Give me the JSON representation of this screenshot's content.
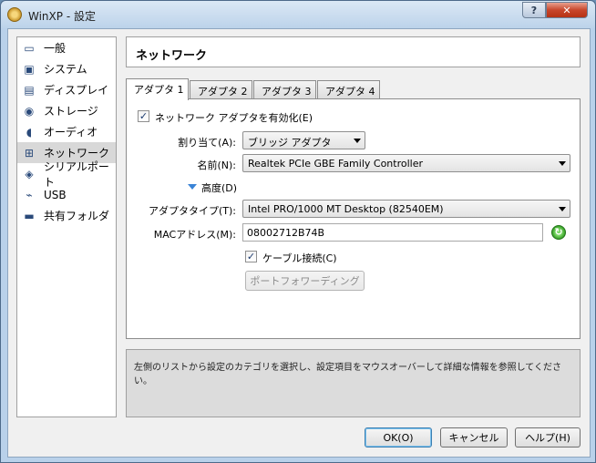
{
  "window": {
    "title": "WinXP - 設定",
    "help_label": "?",
    "close_label": "✕"
  },
  "sidebar": {
    "items": [
      {
        "label": "一般",
        "icon": "monitor-icon",
        "glyph": "▭",
        "selected": false
      },
      {
        "label": "システム",
        "icon": "chip-icon",
        "glyph": "▣",
        "selected": false
      },
      {
        "label": "ディスプレイ",
        "icon": "display-icon",
        "glyph": "▤",
        "selected": false
      },
      {
        "label": "ストレージ",
        "icon": "disk-icon",
        "glyph": "◉",
        "selected": false
      },
      {
        "label": "オーディオ",
        "icon": "speaker-icon",
        "glyph": "◖",
        "selected": false
      },
      {
        "label": "ネットワーク",
        "icon": "network-icon",
        "glyph": "⊞",
        "selected": true
      },
      {
        "label": "シリアルポート",
        "icon": "serial-port-icon",
        "glyph": "◈",
        "selected": false
      },
      {
        "label": "USB",
        "icon": "usb-icon",
        "glyph": "⌁",
        "selected": false
      },
      {
        "label": "共有フォルダ",
        "icon": "folder-icon",
        "glyph": "▬",
        "selected": false
      }
    ]
  },
  "header": {
    "title": "ネットワーク"
  },
  "tabs": [
    {
      "label": "アダプタ 1",
      "active": true
    },
    {
      "label": "アダプタ 2",
      "active": false
    },
    {
      "label": "アダプタ 3",
      "active": false
    },
    {
      "label": "アダプタ 4",
      "active": false
    }
  ],
  "panel": {
    "enable_adapter": {
      "label": "ネットワーク アダプタを有効化(E)",
      "checked": true,
      "check_glyph": "✓"
    },
    "attached_to": {
      "label": "割り当て(A):",
      "value": "ブリッジ アダプタ"
    },
    "name": {
      "label": "名前(N):",
      "value": "Realtek PCIe GBE Family Controller"
    },
    "advanced": {
      "label": "高度(D)"
    },
    "adapter_type": {
      "label": "アダプタタイプ(T):",
      "value": "Intel PRO/1000 MT Desktop (82540EM)"
    },
    "mac_address": {
      "label": "MACアドレス(M):",
      "value": "08002712B74B",
      "refresh_glyph": "↻"
    },
    "cable_connected": {
      "label": "ケーブル接続(C)",
      "checked": true,
      "check_glyph": "✓"
    },
    "port_forwarding": {
      "label": "ポートフォワーディング"
    }
  },
  "info": {
    "text": "左側のリストから設定のカテゴリを選択し、設定項目をマウスオーバーして詳細な情報を参照してください。"
  },
  "buttons": {
    "ok": "OK(O)",
    "cancel": "キャンセル",
    "help": "ヘルプ(H)"
  }
}
